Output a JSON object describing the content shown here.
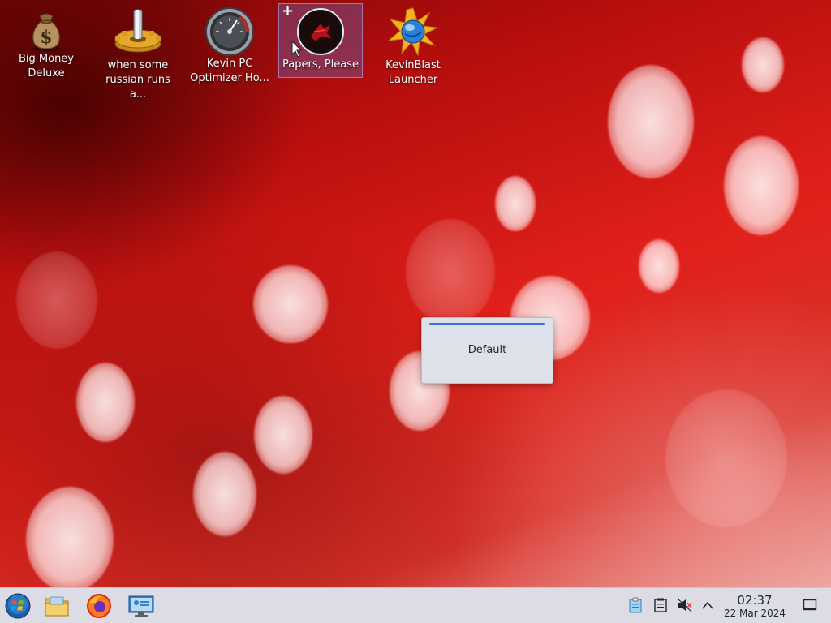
{
  "desktop": {
    "icons": [
      {
        "label": "Big Money\nDeluxe",
        "icon": "money-bag-icon"
      },
      {
        "label": "when some\nrussian runs a...",
        "icon": "gear-icon"
      },
      {
        "label": "Kevin PC\nOptimizer Ho...",
        "icon": "speedometer-icon"
      },
      {
        "label": "Papers, Please",
        "icon": "papers-please-icon",
        "selected": true
      },
      {
        "label": "KevinBlast\nLauncher",
        "icon": "globe-burst-icon"
      }
    ],
    "osd": {
      "text": "Default"
    }
  },
  "taskbar": {
    "launchers": [
      "start-menu-icon",
      "file-manager-icon",
      "firefox-icon",
      "system-settings-icon"
    ],
    "tray": [
      "clipboard-icon",
      "notes-icon",
      "volume-muted-icon",
      "chevron-up-icon"
    ],
    "clock": {
      "time": "02:37",
      "date": "22 Mar 2024"
    },
    "show_desktop": "show-desktop-icon"
  },
  "colors": {
    "taskbar_bg": "#dcdde4",
    "selection": "#6e5aa0",
    "osd_accent": "#3d6fd6"
  }
}
